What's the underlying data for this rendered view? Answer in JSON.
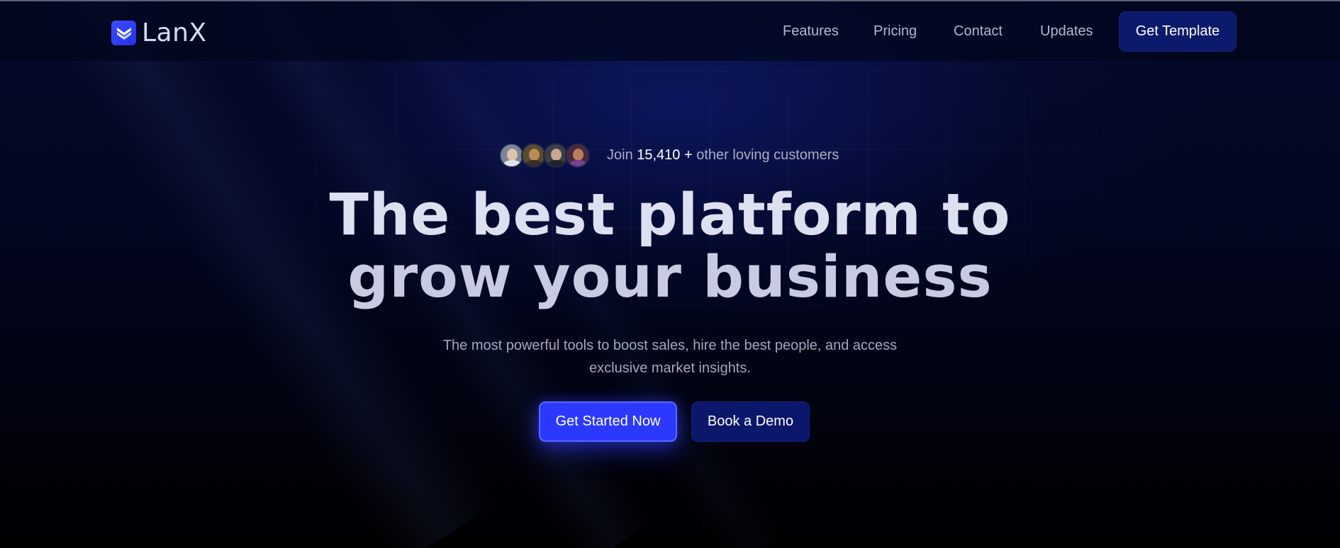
{
  "nav": {
    "brand": "LanX",
    "links": [
      {
        "label": "Features"
      },
      {
        "label": "Pricing"
      },
      {
        "label": "Contact"
      },
      {
        "label": "Updates"
      }
    ],
    "cta_label": "Get Template"
  },
  "hero": {
    "social_proof": {
      "prefix": "Join ",
      "count": "15,410 +",
      "suffix": " other loving customers",
      "avatars": [
        "avatar-1",
        "avatar-2",
        "avatar-3",
        "avatar-4"
      ]
    },
    "headline_line1": "The best platform to",
    "headline_line2": "grow your business",
    "subheadline_line1": "The most powerful tools to boost sales, hire the best people, and access",
    "subheadline_line2": "exclusive market insights.",
    "primary_cta": "Get Started Now",
    "secondary_cta": "Book a Demo"
  },
  "colors": {
    "background": "#000208",
    "accent": "#2b39ff",
    "nav_button": "#0b1a6a"
  },
  "icons": {
    "logo": "lanx-logo-icon"
  }
}
